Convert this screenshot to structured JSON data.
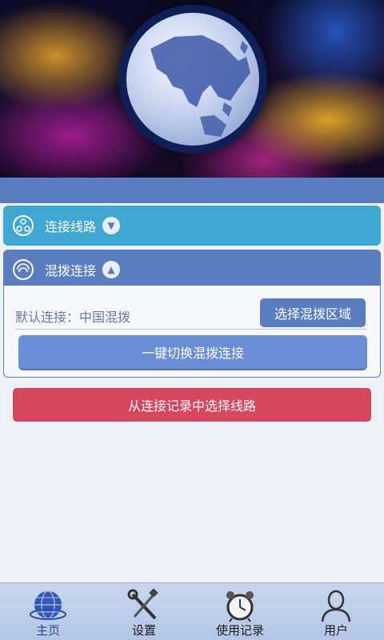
{
  "panels": {
    "route_label": "连接线路",
    "mix_label": "混拨连接"
  },
  "mix": {
    "default_label": "默认连接：中国混拨",
    "select_region_button": "选择混拨区域",
    "switch_button": "一键切换混拨连接"
  },
  "history_button": "从连接记录中选择线路",
  "tabbar": {
    "items": [
      {
        "label": "主页",
        "icon": "globe-icon",
        "active": true
      },
      {
        "label": "设置",
        "icon": "tools-icon",
        "active": false
      },
      {
        "label": "使用记录",
        "icon": "alarm-clock-icon",
        "active": false
      },
      {
        "label": "用户",
        "icon": "user-icon",
        "active": false
      }
    ]
  },
  "colors": {
    "accent_blue": "#5b7ec2",
    "route_blue": "#3fa8d2",
    "history_red": "#d6475f"
  }
}
